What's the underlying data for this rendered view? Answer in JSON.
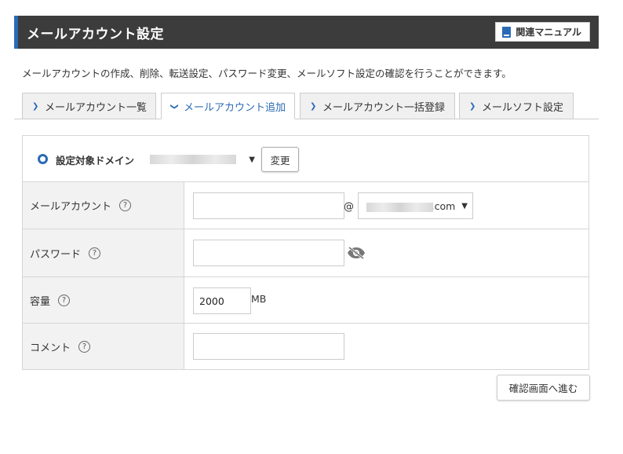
{
  "header": {
    "title": "メールアカウント設定",
    "manual_button": "関連マニュアル",
    "manual_icon": "book-icon"
  },
  "description": "メールアカウントの作成、削除、転送設定、パスワード変更、メールソフト設定の確認を行うことができます。",
  "tabs": [
    {
      "label": "メールアカウント一覧",
      "active": false
    },
    {
      "label": "メールアカウント追加",
      "active": true
    },
    {
      "label": "メールアカウント一括登録",
      "active": false
    },
    {
      "label": "メールソフト設定",
      "active": false
    }
  ],
  "domain": {
    "label": "設定対象ドメイン",
    "change_button": "変更"
  },
  "form": {
    "email": {
      "label": "メールアカウント",
      "value": "",
      "at": "@",
      "domain_suffix": ".com"
    },
    "password": {
      "label": "パスワード",
      "value": ""
    },
    "capacity": {
      "label": "容量",
      "value": "2000",
      "unit": "MB"
    },
    "comment": {
      "label": "コメント",
      "value": ""
    },
    "help_symbol": "?"
  },
  "confirm_button": "確認画面へ進む",
  "colors": {
    "accent": "#2a6ab5",
    "header_bg": "#3c3c3c",
    "label_bg": "#f2f2f2"
  }
}
